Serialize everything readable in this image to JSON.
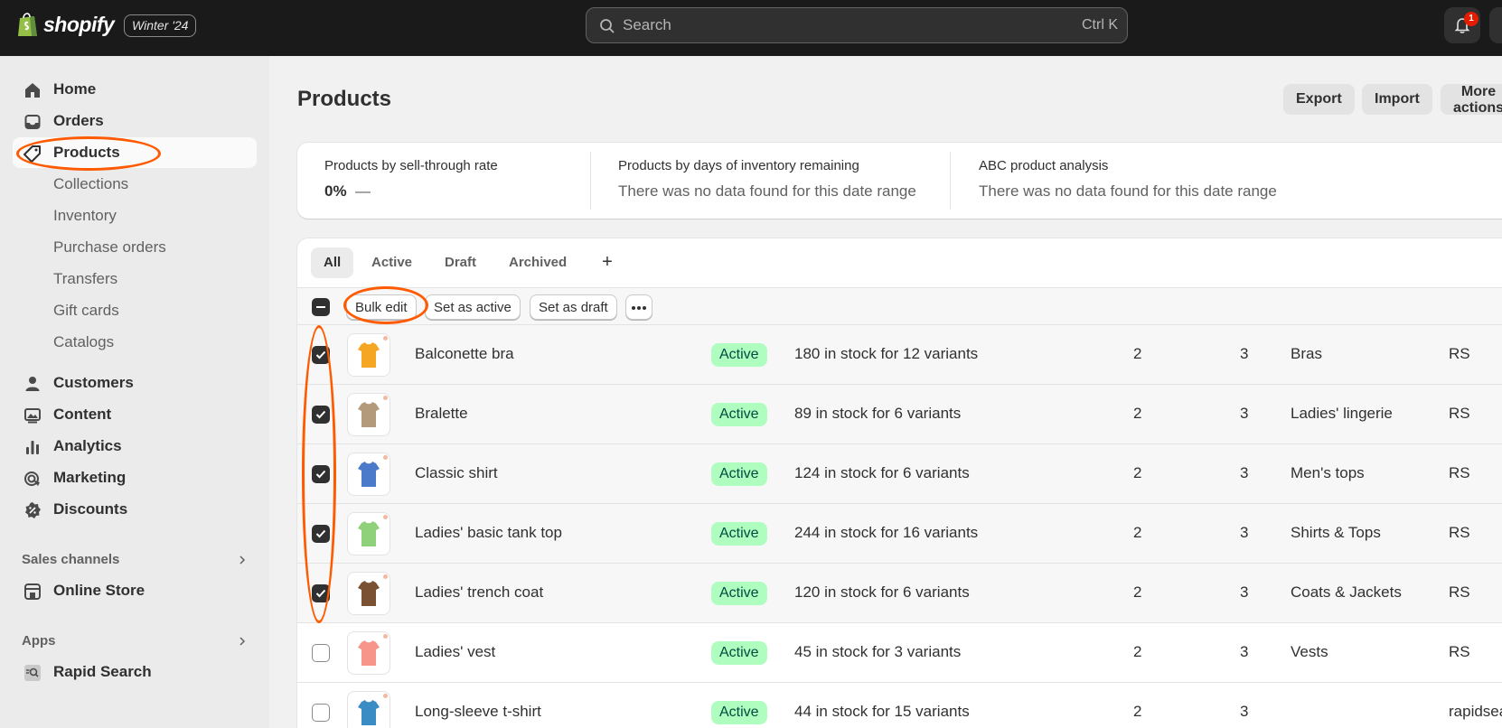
{
  "topbar": {
    "brand": "shopify",
    "edition": "Winter '24",
    "search_placeholder": "Search",
    "shortcut": "Ctrl K",
    "notification_count": "1"
  },
  "sidebar": {
    "items": [
      {
        "label": "Home",
        "icon": "home-icon"
      },
      {
        "label": "Orders",
        "icon": "inbox-icon"
      },
      {
        "label": "Products",
        "icon": "tag-icon"
      },
      {
        "label": "Collections"
      },
      {
        "label": "Inventory"
      },
      {
        "label": "Purchase orders"
      },
      {
        "label": "Transfers"
      },
      {
        "label": "Gift cards"
      },
      {
        "label": "Catalogs"
      },
      {
        "label": "Customers",
        "icon": "person-icon"
      },
      {
        "label": "Content",
        "icon": "image-icon"
      },
      {
        "label": "Analytics",
        "icon": "bar-chart-icon"
      },
      {
        "label": "Marketing",
        "icon": "target-icon"
      },
      {
        "label": "Discounts",
        "icon": "discount-icon"
      }
    ],
    "sales_channels_title": "Sales channels",
    "online_store": "Online Store",
    "apps_title": "Apps",
    "rapid_search": "Rapid Search"
  },
  "page": {
    "title": "Products",
    "export_label": "Export",
    "import_label": "Import",
    "more_label": "More actions"
  },
  "metrics": [
    {
      "label": "Products by sell-through rate",
      "value": "0%",
      "suffix": "—"
    },
    {
      "label": "Products by days of inventory remaining",
      "value": "There was no data found for this date range"
    },
    {
      "label": "ABC product analysis",
      "value": "There was no data found for this date range"
    }
  ],
  "tabs": [
    "All",
    "Active",
    "Draft",
    "Archived"
  ],
  "toolbar": {
    "bulk_edit": "Bulk edit",
    "set_active": "Set as active",
    "set_draft": "Set as draft"
  },
  "products": [
    {
      "name": "Balconette bra",
      "status": "Active",
      "inventory": "180 in stock for 12 variants",
      "sales_channels": "2",
      "markets": "3",
      "category": "Bras",
      "vendor": "RS",
      "selected": true,
      "color": "#f5a623"
    },
    {
      "name": "Bralette",
      "status": "Active",
      "inventory": "89 in stock for 6 variants",
      "sales_channels": "2",
      "markets": "3",
      "category": "Ladies' lingerie",
      "vendor": "RS",
      "selected": true,
      "color": "#b39a7a"
    },
    {
      "name": "Classic shirt",
      "status": "Active",
      "inventory": "124 in stock for 6 variants",
      "sales_channels": "2",
      "markets": "3",
      "category": "Men's tops",
      "vendor": "RS",
      "selected": true,
      "color": "#4a7ac9"
    },
    {
      "name": "Ladies' basic tank top",
      "status": "Active",
      "inventory": "244 in stock for 16 variants",
      "sales_channels": "2",
      "markets": "3",
      "category": "Shirts & Tops",
      "vendor": "RS",
      "selected": true,
      "color": "#8fd17a"
    },
    {
      "name": "Ladies' trench coat",
      "status": "Active",
      "inventory": "120 in stock for 6 variants",
      "sales_channels": "2",
      "markets": "3",
      "category": "Coats & Jackets",
      "vendor": "RS",
      "selected": true,
      "color": "#7a5233"
    },
    {
      "name": "Ladies' vest",
      "status": "Active",
      "inventory": "45 in stock for 3 variants",
      "sales_channels": "2",
      "markets": "3",
      "category": "Vests",
      "vendor": "RS",
      "selected": false,
      "color": "#f7958a"
    },
    {
      "name": "Long-sleeve t-shirt",
      "status": "Active",
      "inventory": "44 in stock for 15 variants",
      "sales_channels": "2",
      "markets": "3",
      "category": "",
      "vendor": "rapidsearch",
      "selected": false,
      "color": "#3a8cc4"
    }
  ],
  "colors": {
    "accent": "#ff5a00",
    "active_badge_bg": "#affebf",
    "topbar": "#1a1a1a"
  }
}
